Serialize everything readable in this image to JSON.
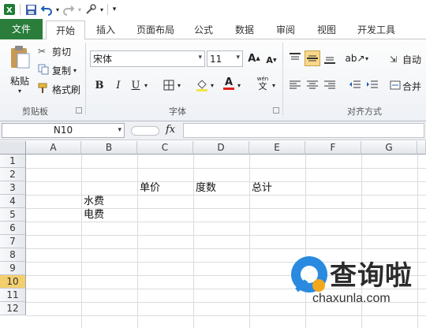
{
  "tabs": [
    "文件",
    "开始",
    "插入",
    "页面布局",
    "公式",
    "数据",
    "审阅",
    "视图",
    "开发工具"
  ],
  "clipboard": {
    "paste": "粘贴",
    "cut": "剪切",
    "copy": "复制",
    "format_painter": "格式刷",
    "group_label": "剪贴板"
  },
  "font": {
    "name": "宋体",
    "size": "11",
    "bold": "B",
    "italic": "I",
    "underline": "U",
    "group_label": "字体"
  },
  "alignment": {
    "wrap": "自动",
    "merge": "合并",
    "group_label": "对齐方式"
  },
  "formula_bar": {
    "name_box": "N10",
    "fx": "fx",
    "formula": ""
  },
  "sheet": {
    "columns": [
      "A",
      "B",
      "C",
      "D",
      "E",
      "F",
      "G"
    ],
    "rows": [
      "1",
      "2",
      "3",
      "4",
      "5",
      "6",
      "7",
      "8",
      "9",
      "10",
      "11",
      "12"
    ],
    "active_row": "10",
    "cells": {
      "C3": "单价",
      "D3": "度数",
      "E3": "总计",
      "B4": "水费",
      "B5": "电费"
    }
  },
  "watermark": {
    "brand": "查询啦",
    "url": "chaxunla.com",
    "accent": "#2a8ae0"
  }
}
